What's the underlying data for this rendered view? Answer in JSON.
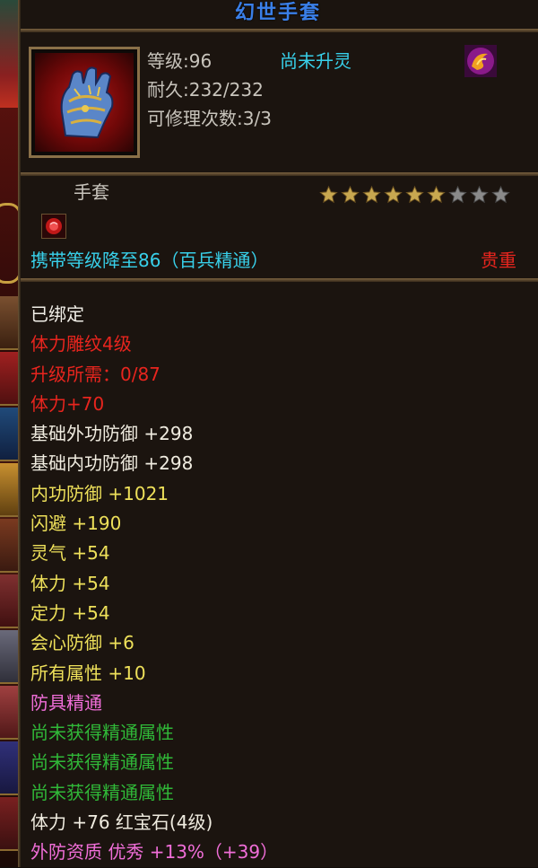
{
  "item": {
    "name": "幻世手套",
    "level_label": "等级:96",
    "spirit_status": "尚未升灵",
    "durability_label": "耐久:232/232",
    "repair_label": "可修理次数:3/3",
    "type": "手套",
    "stars_filled": 6,
    "stars_total": 9,
    "carry_level_text": "携带等级降至86（百兵精通）",
    "rarity": "贵重"
  },
  "icons": {
    "item_icon": "gauntlet-icon",
    "skill_icon": "flame-swirl-icon",
    "buff_icon": "red-gem-icon"
  },
  "stats": [
    {
      "text": "已绑定",
      "color": "white"
    },
    {
      "text": "体力雕纹4级",
      "color": "red"
    },
    {
      "text": "升级所需：0/87",
      "color": "red"
    },
    {
      "text": "体力+70",
      "color": "red"
    },
    {
      "text": "基础外功防御 +298",
      "color": "cream"
    },
    {
      "text": "基础内功防御 +298",
      "color": "cream"
    },
    {
      "text": "内功防御 +1021",
      "color": "yellow"
    },
    {
      "text": "闪避 +190",
      "color": "yellow"
    },
    {
      "text": "灵气 +54",
      "color": "yellow"
    },
    {
      "text": "体力 +54",
      "color": "yellow"
    },
    {
      "text": "定力 +54",
      "color": "yellow"
    },
    {
      "text": "会心防御 +6",
      "color": "yellow"
    },
    {
      "text": "所有属性 +10",
      "color": "yellow"
    },
    {
      "text": "防具精通",
      "color": "pink"
    },
    {
      "text": "尚未获得精通属性",
      "color": "green"
    },
    {
      "text": "尚未获得精通属性",
      "color": "green"
    },
    {
      "text": "尚未获得精通属性",
      "color": "green"
    },
    {
      "text": "体力 +76 红宝石(4级)",
      "color": "cream"
    },
    {
      "text": "外防资质  优秀 +13%（+39）",
      "color": "pink"
    }
  ],
  "colors": {
    "title": "#3a7fe8",
    "cyan": "#38d0ea",
    "red": "#e8251e",
    "yellow": "#eee05a",
    "pink": "#f06ed8",
    "green": "#30b838",
    "star_filled": "#c8a850",
    "star_empty": "#8a8a8a"
  }
}
